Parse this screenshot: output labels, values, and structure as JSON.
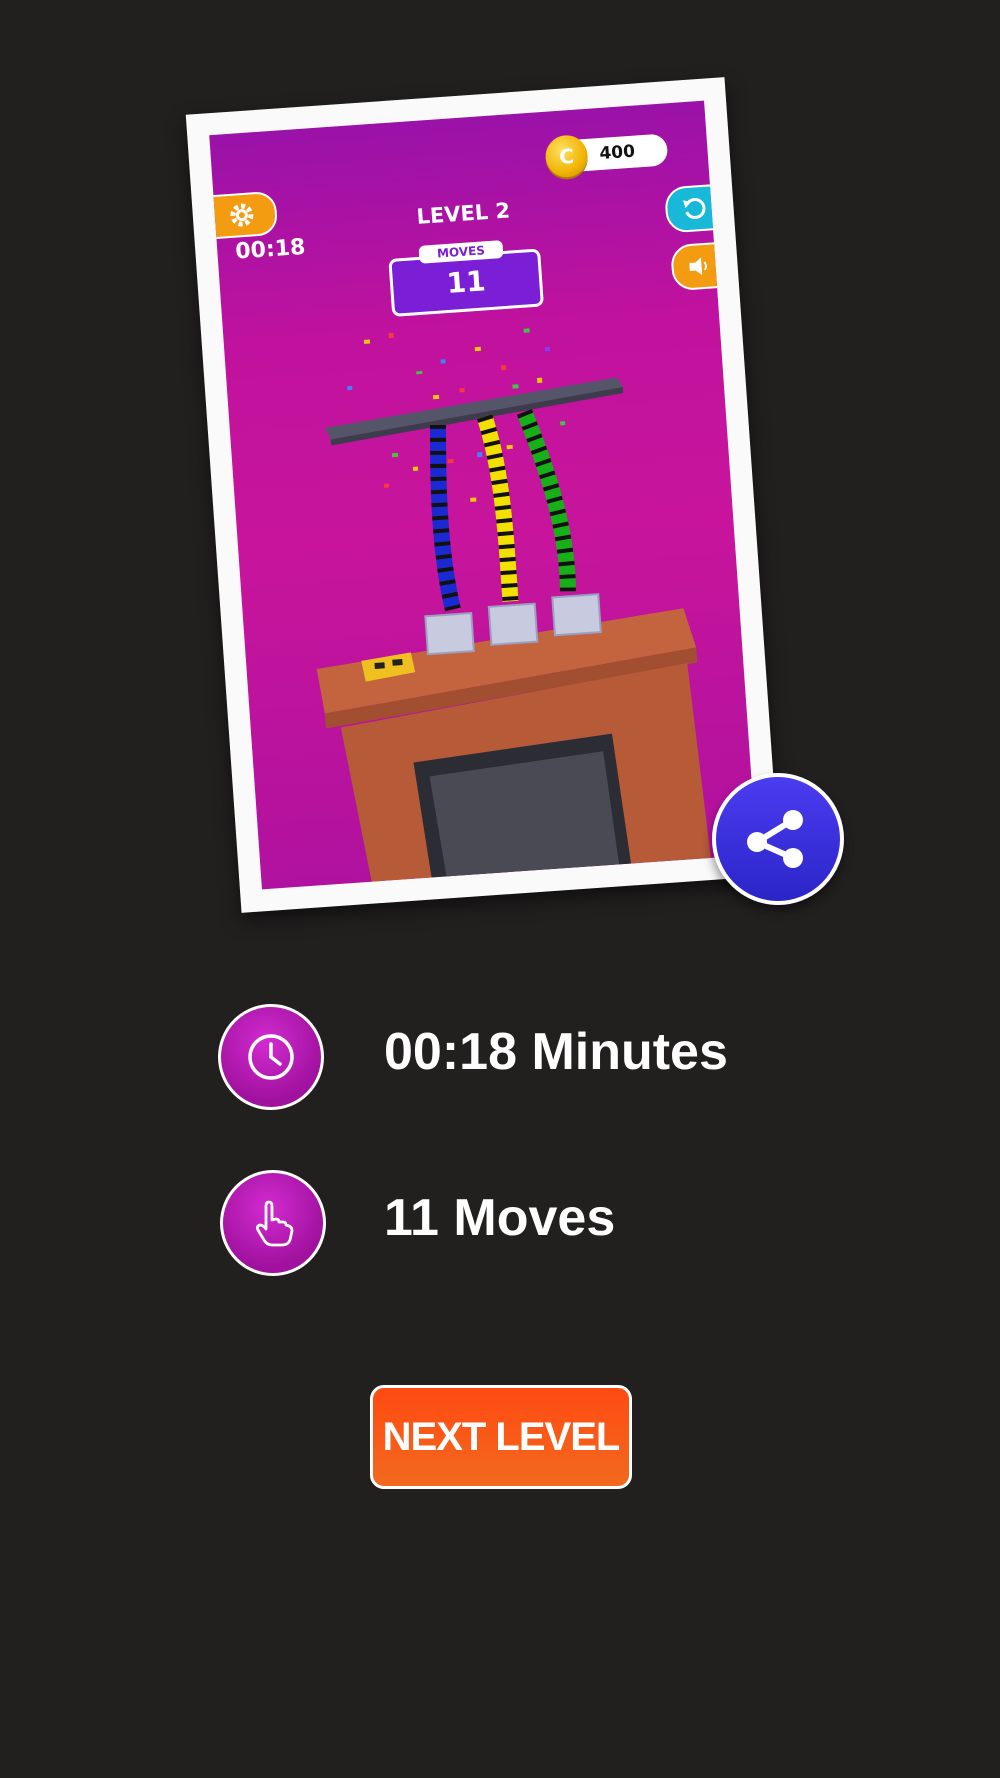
{
  "screenshot": {
    "coins": "400",
    "coin_symbol": "C",
    "timer": "00:18",
    "level": "LEVEL 2",
    "moves_label": "MOVES",
    "moves_value": "11"
  },
  "stats": {
    "time": "00:18 Minutes",
    "moves": "11 Moves"
  },
  "next_button": "NEXT LEVEL",
  "colors": {
    "background": "#221f1f",
    "accent_purple": "#a0119e",
    "share_blue": "#3a30e0",
    "next_orange": "#ff5a14"
  },
  "icons": [
    "gear-icon",
    "restart-icon",
    "sound-icon",
    "share-icon",
    "clock-icon",
    "hand-pointer-icon"
  ]
}
